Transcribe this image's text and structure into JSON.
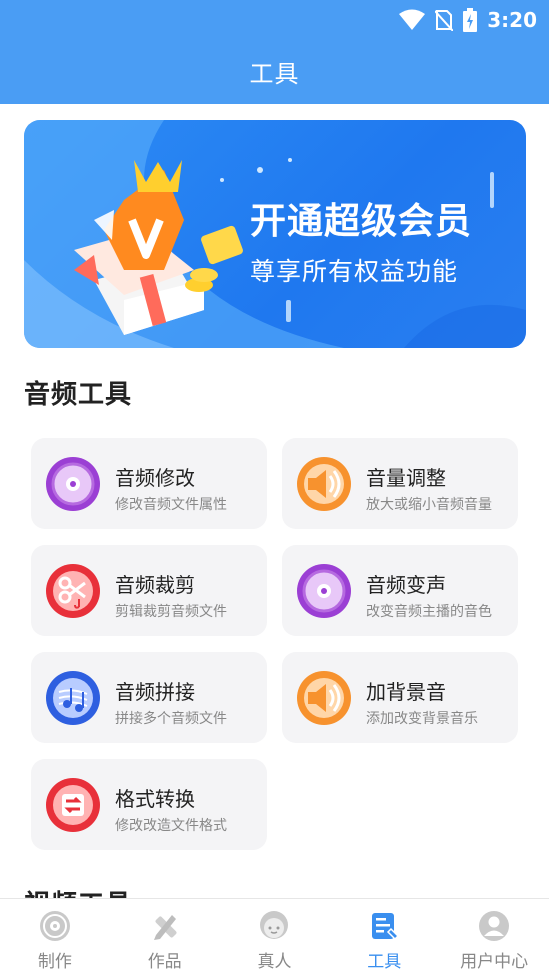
{
  "status_bar": {
    "time": "3:20"
  },
  "app_bar": {
    "title": "工具"
  },
  "banner": {
    "title": "开通超级会员",
    "subtitle": "尊享所有权益功能"
  },
  "audio_section": {
    "title": "音频工具",
    "tools": [
      {
        "title": "音频修改",
        "desc": "修改音频文件属性",
        "icon": "purple-disc-icon"
      },
      {
        "title": "音量调整",
        "desc": "放大或缩小音频音量",
        "icon": "orange-volume-icon"
      },
      {
        "title": "音频裁剪",
        "desc": "剪辑裁剪音频文件",
        "icon": "red-scissors-icon"
      },
      {
        "title": "音频变声",
        "desc": "改变音频主播的音色",
        "icon": "purple-disc-icon"
      },
      {
        "title": "音频拼接",
        "desc": "拼接多个音频文件",
        "icon": "blue-music-icon"
      },
      {
        "title": "加背景音",
        "desc": "添加改变背景音乐",
        "icon": "orange-volume-icon"
      },
      {
        "title": "格式转换",
        "desc": "修改改造文件格式",
        "icon": "red-convert-icon"
      }
    ]
  },
  "next_section": {
    "title": "视频工具"
  },
  "tab_bar": {
    "items": [
      {
        "label": "制作",
        "icon": "disc-icon"
      },
      {
        "label": "作品",
        "icon": "pen-ruler-icon"
      },
      {
        "label": "真人",
        "icon": "person-face-icon"
      },
      {
        "label": "工具",
        "icon": "toolbox-icon",
        "active": true
      },
      {
        "label": "用户中心",
        "icon": "user-icon"
      }
    ]
  },
  "colors": {
    "primary": "#4a9df4",
    "active_tab": "#3a8fef",
    "card_bg": "#f4f4f6",
    "purple_icon": "#9b3fd4",
    "orange_icon": "#f7922e",
    "red_icon": "#e8303a",
    "blue_icon": "#2e5fe0"
  }
}
